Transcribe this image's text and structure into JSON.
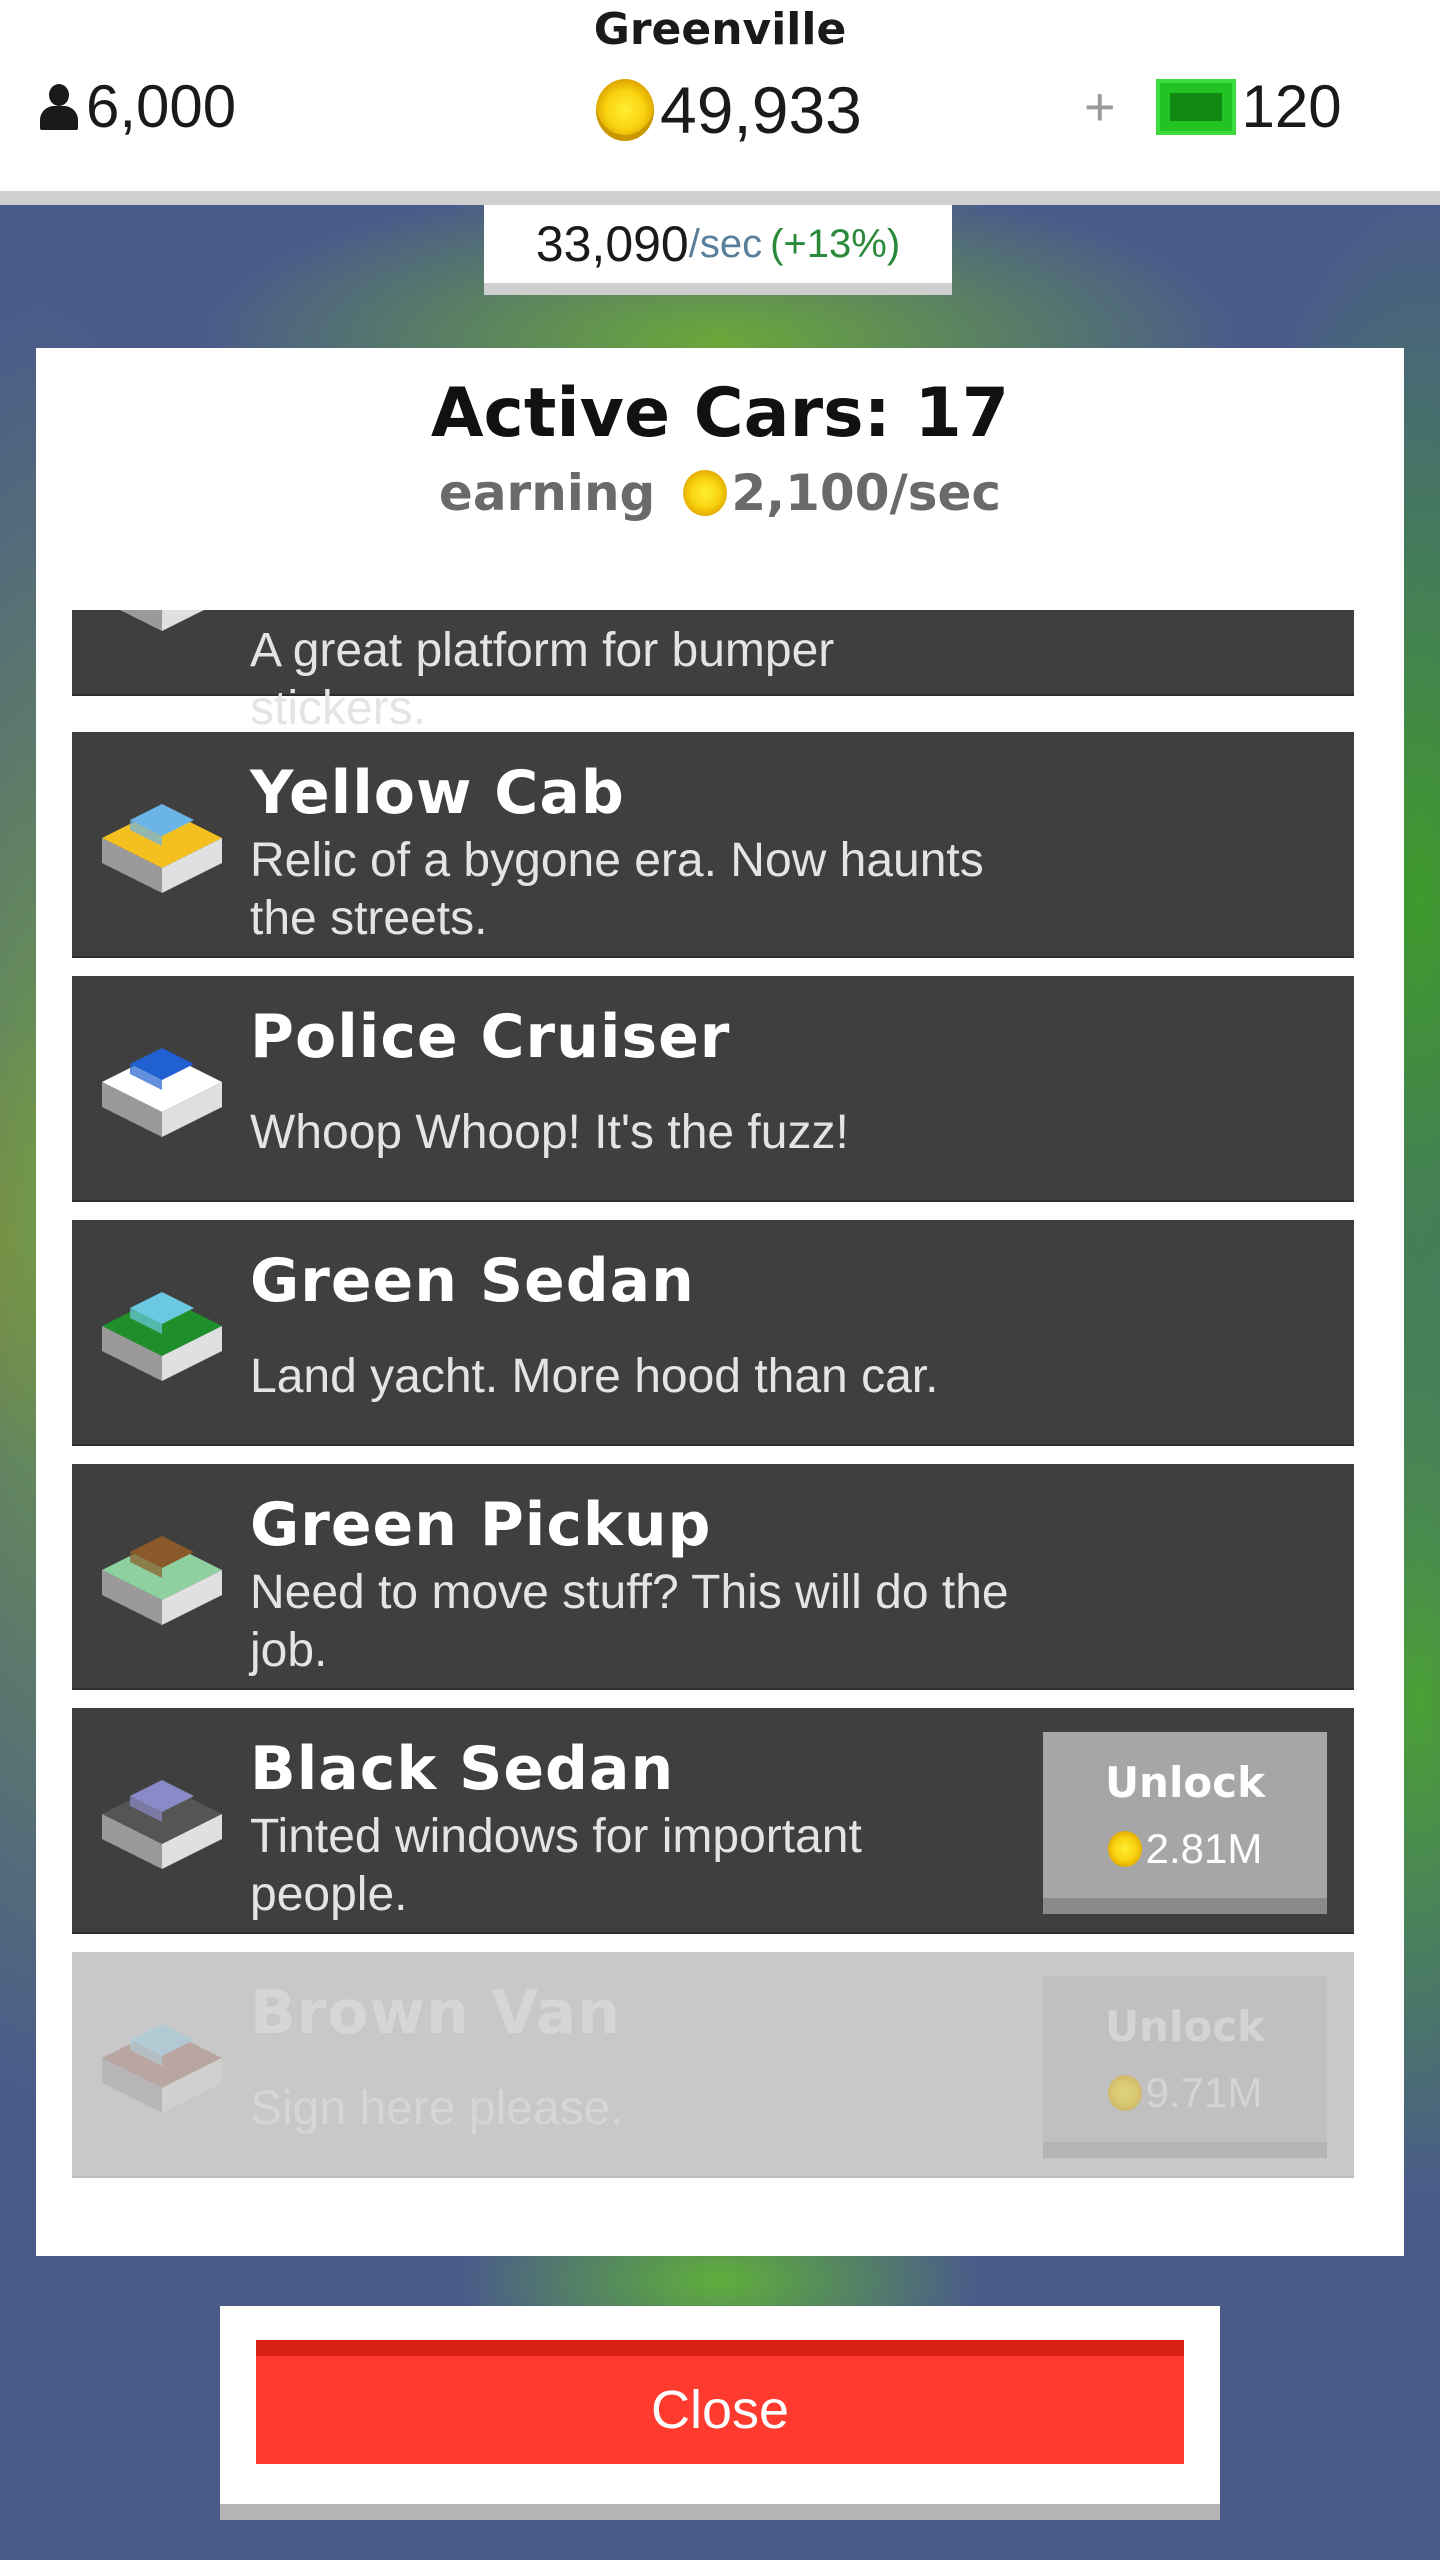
{
  "header": {
    "city": "Greenville",
    "population": "6,000",
    "coins": "49,933",
    "plus": "+",
    "cash": "120"
  },
  "rate": {
    "value": "33,090",
    "unit": "/sec",
    "bonus": "(+13%)"
  },
  "panel": {
    "title": "Active Cars: 17",
    "earning_label": "earning",
    "earning_value": "2,100/sec"
  },
  "cars": [
    {
      "name": "",
      "desc": "A great platform for bumper stickers.",
      "icon": "sedan-car-icon",
      "colors": [
        "#3fa9e0",
        "#d8d8d8"
      ]
    },
    {
      "name": "Yellow Cab",
      "desc": "Relic of a bygone era. Now haunts the streets.",
      "icon": "yellow-cab-icon",
      "colors": [
        "#f4c020",
        "#6ab4e8"
      ]
    },
    {
      "name": "Police Cruiser",
      "desc": "Whoop Whoop! It's the fuzz!",
      "icon": "police-cruiser-icon",
      "colors": [
        "#ffffff",
        "#2060d0"
      ]
    },
    {
      "name": "Green Sedan",
      "desc": "Land yacht. More hood than car.",
      "icon": "green-sedan-icon",
      "colors": [
        "#1f8f2a",
        "#6ac8e0"
      ]
    },
    {
      "name": "Green Pickup",
      "desc": "Need to move stuff? This will do the job.",
      "icon": "green-pickup-icon",
      "colors": [
        "#8fd0a0",
        "#8a5a2a"
      ]
    },
    {
      "name": "Black Sedan",
      "desc": "Tinted windows for important people.",
      "icon": "black-sedan-icon",
      "colors": [
        "#555555",
        "#8a8ac8"
      ],
      "unlock_label": "Unlock",
      "cost": "2.81M"
    },
    {
      "name": "Brown Van",
      "desc": "Sign here please.",
      "icon": "brown-van-icon",
      "colors": [
        "#a06a5a",
        "#8ac8e8"
      ],
      "unlock_label": "Unlock",
      "cost": "9.71M",
      "locked": true
    }
  ],
  "close_label": "Close"
}
